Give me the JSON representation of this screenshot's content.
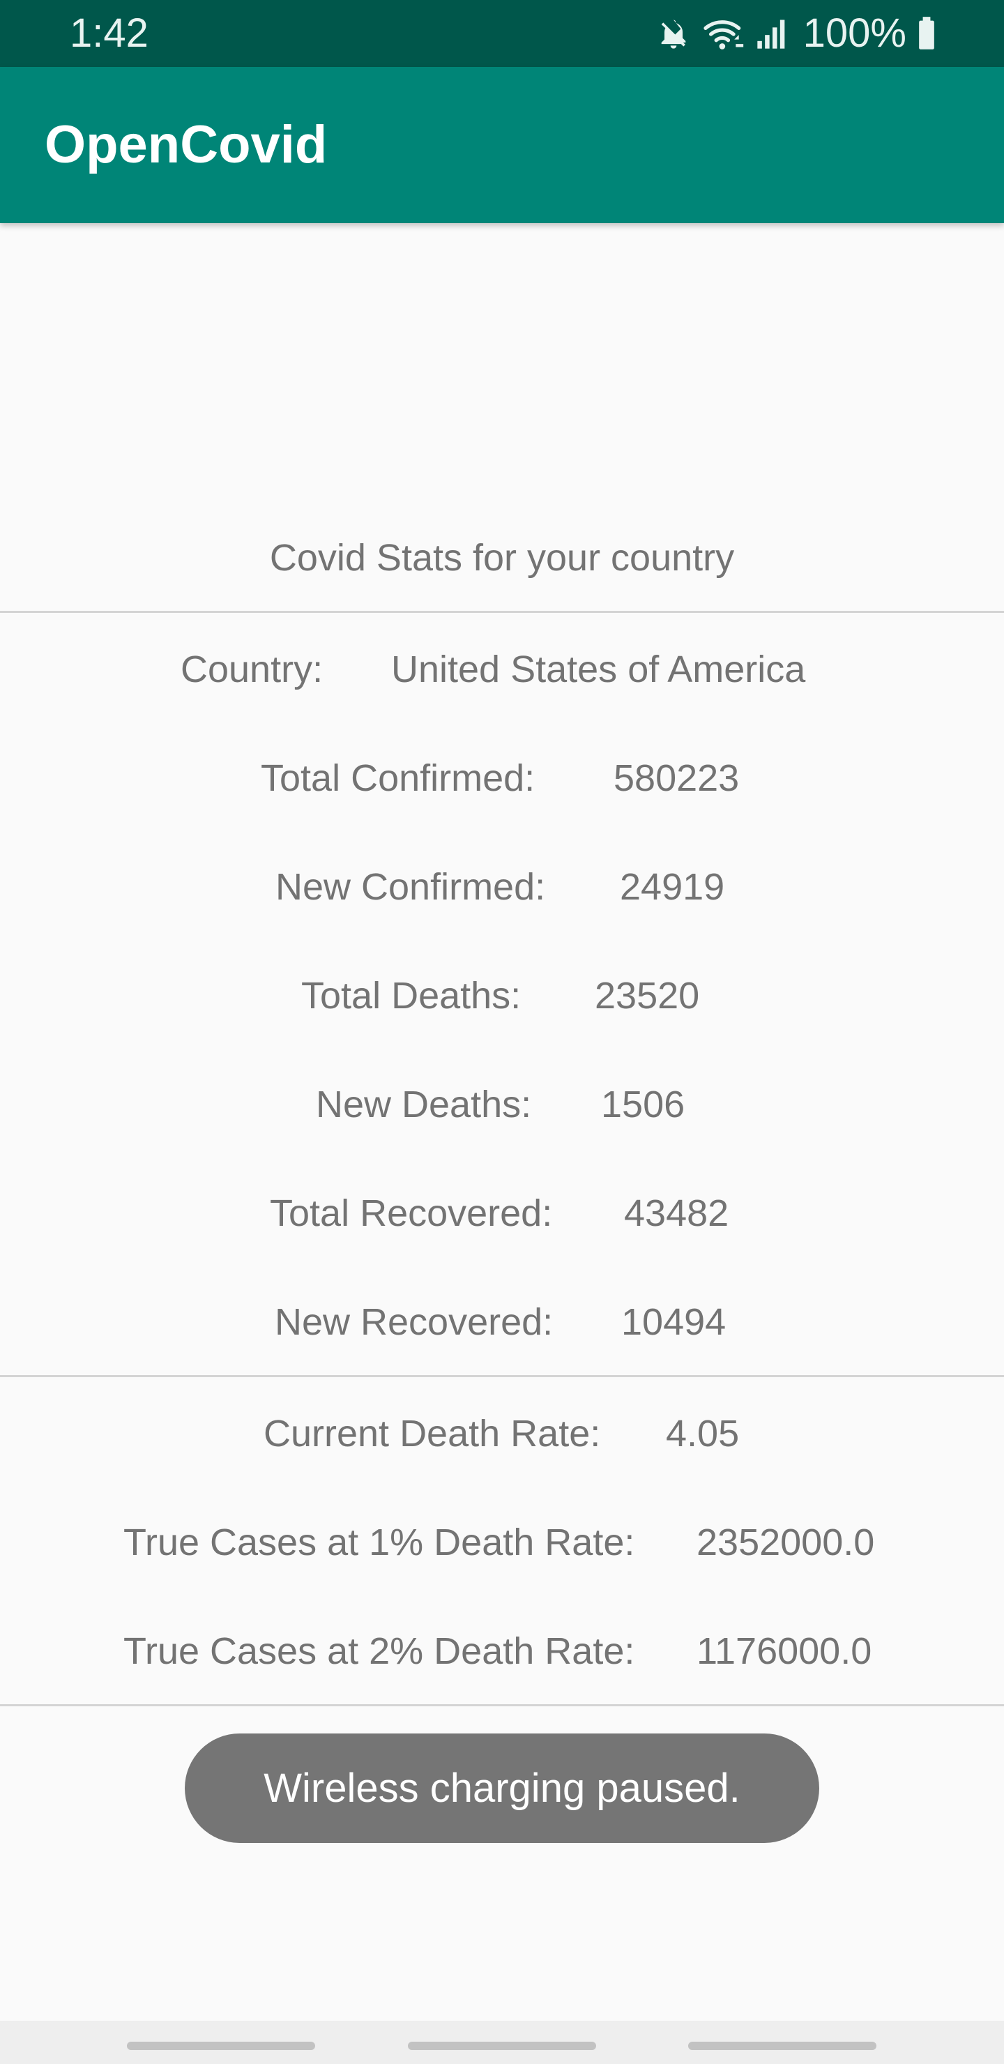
{
  "status_bar": {
    "time": "1:42",
    "battery_text": "100%",
    "icons": [
      "mute-icon",
      "wifi-icon",
      "signal-icon",
      "battery-icon"
    ]
  },
  "app_bar": {
    "title": "OpenCovid"
  },
  "stats": {
    "heading": "Covid Stats for your country",
    "country_label": "Country:",
    "country_value": "United States of America",
    "total_confirmed_label": "Total Confirmed:",
    "total_confirmed_value": "580223",
    "new_confirmed_label": "New Confirmed:",
    "new_confirmed_value": "24919",
    "total_deaths_label": "Total Deaths:",
    "total_deaths_value": "23520",
    "new_deaths_label": "New Deaths:",
    "new_deaths_value": "1506",
    "total_recovered_label": "Total Recovered:",
    "total_recovered_value": "43482",
    "new_recovered_label": "New Recovered:",
    "new_recovered_value": "10494"
  },
  "rates": {
    "death_rate_label": "Current Death Rate:",
    "death_rate_value": "4.05",
    "true_cases_1_label": "True Cases at 1% Death Rate:",
    "true_cases_1_value": "2352000.0",
    "true_cases_2_label": "True Cases at 2% Death Rate:",
    "true_cases_2_value": "1176000.0"
  },
  "toast": {
    "message": "Wireless charging paused."
  },
  "colors": {
    "status_bar": "#00574b",
    "app_bar": "#008577",
    "text": "#737373",
    "toast": "#757575"
  }
}
